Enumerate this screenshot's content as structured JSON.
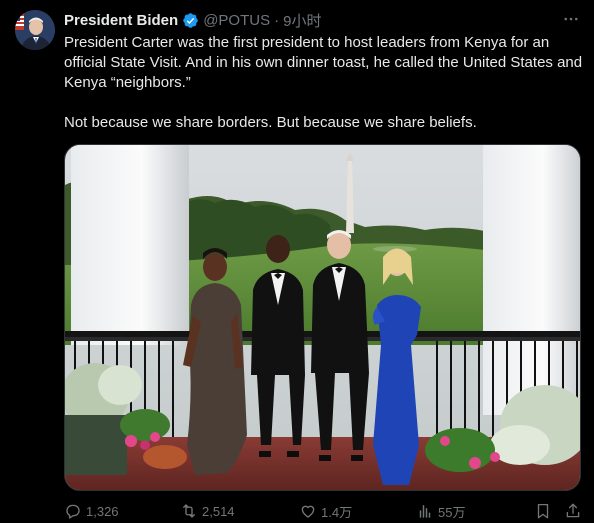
{
  "author": {
    "name": "President Biden",
    "handle": "@POTUS",
    "separator": "·",
    "time": "9小时"
  },
  "tweet": {
    "paragraph1": "President Carter was the first president to host leaders from Kenya for an official State Visit. And in his own dinner toast, he called the United States and Kenya “neighbors.”",
    "paragraph2": "Not because we share borders. But because we share beliefs."
  },
  "actions": {
    "replies": "1,326",
    "retweets": "2,514",
    "likes": "1.4万",
    "views": "55万"
  },
  "icons": {
    "verified": "verified-badge-icon",
    "more": "more-options-icon",
    "reply": "reply-icon",
    "retweet": "retweet-icon",
    "like": "heart-icon",
    "views": "views-chart-icon",
    "bookmark": "bookmark-icon",
    "share": "share-icon"
  },
  "colors": {
    "background": "#000000",
    "text": "#e7e9ea",
    "muted": "#71767b",
    "verified": "#1d9bf0"
  }
}
